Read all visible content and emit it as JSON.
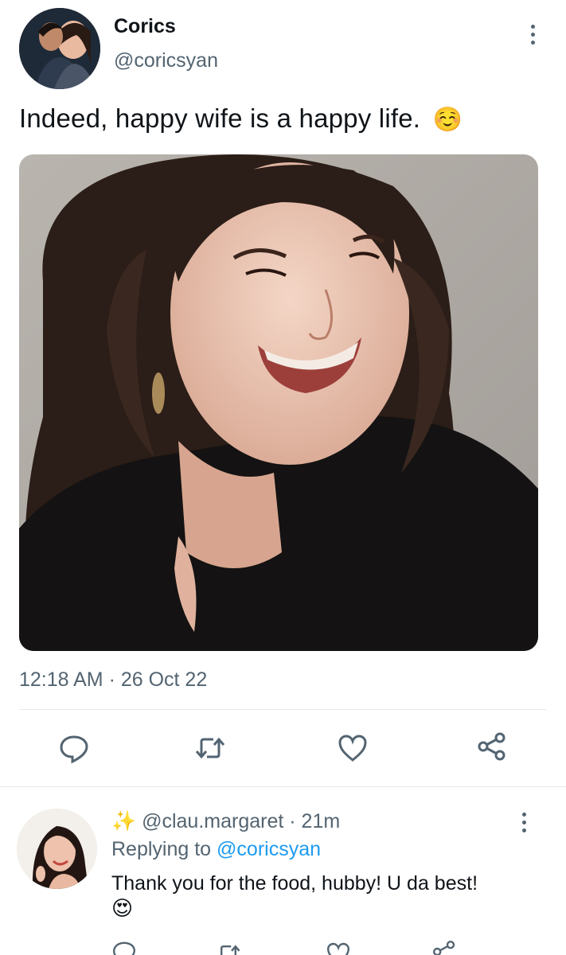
{
  "tweet": {
    "author_name": "Corics",
    "author_handle": "@coricsyan",
    "text": "Indeed, happy wife is a happy life.",
    "emoji": "☺️",
    "timestamp": "12:18 AM · 26 Oct 22"
  },
  "actions": {
    "icons": [
      "reply-icon",
      "retweet-icon",
      "like-icon",
      "share-icon"
    ]
  },
  "reply": {
    "sparkle": "✨",
    "handle": "@clau.margaret",
    "time": "· 21m",
    "replying_prefix": "Replying to",
    "replying_handle": "@coricsyan",
    "text": "Thank you for the food, hubby! U da best!",
    "emoji": "😍"
  },
  "colors": {
    "text_primary": "#0f1419",
    "text_secondary": "#536471",
    "link": "#1d9bf0",
    "divider": "#e6e9eb"
  }
}
